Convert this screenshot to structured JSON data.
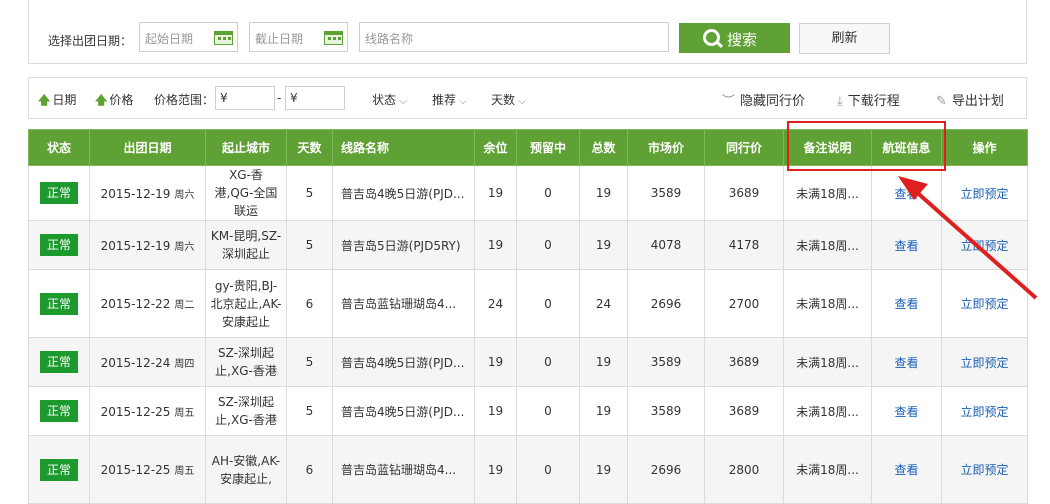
{
  "search": {
    "date_label": "选择出团日期：",
    "start_placeholder": "起始日期",
    "end_placeholder": "截止日期",
    "route_placeholder": "线路名称",
    "search_button": "搜索",
    "refresh_button": "刷新"
  },
  "toolbar": {
    "sort_date": "日期",
    "sort_price": "价格",
    "price_range_label": "价格范围：",
    "price_min": "¥",
    "price_sep": "-",
    "price_max": "¥",
    "status_dd": "状态",
    "recommend_dd": "推荐",
    "days_dd": "天数",
    "hide_peer_price": "隐藏同行价",
    "download_itinerary": "下载行程",
    "export_plan": "导出计划"
  },
  "table": {
    "headers": [
      "状态",
      "出团日期",
      "起止城市",
      "天数",
      "线路名称",
      "余位",
      "预留中",
      "总数",
      "市场价",
      "同行价",
      "备注说明",
      "航班信息",
      "操作"
    ],
    "rows": [
      {
        "status": "正常",
        "date": "2015-12-19",
        "weekday": "周六",
        "cities": "XG-香港,QG-全国联运",
        "days": "5",
        "route": "普吉岛4晚5日游(PJD...",
        "remain": "19",
        "reserved": "0",
        "total": "19",
        "market": "3589",
        "peer": "3689",
        "note": "未满18周...",
        "flight": "查看",
        "action": "立即预定"
      },
      {
        "status": "正常",
        "date": "2015-12-19",
        "weekday": "周六",
        "cities": "KM-昆明,SZ-深圳起止",
        "days": "5",
        "route": "普吉岛5日游(PJD5RY)",
        "remain": "19",
        "reserved": "0",
        "total": "19",
        "market": "4078",
        "peer": "4178",
        "note": "未满18周...",
        "flight": "查看",
        "action": "立即预定"
      },
      {
        "status": "正常",
        "date": "2015-12-22",
        "weekday": "周二",
        "cities": "gy-贵阳,BJ-北京起止,AK-安康起止",
        "days": "6",
        "route": "普吉岛蓝钻珊瑚岛4...",
        "remain": "24",
        "reserved": "0",
        "total": "24",
        "market": "2696",
        "peer": "2700",
        "note": "未满18周...",
        "flight": "查看",
        "action": "立即预定"
      },
      {
        "status": "正常",
        "date": "2015-12-24",
        "weekday": "周四",
        "cities": "SZ-深圳起止,XG-香港",
        "days": "5",
        "route": "普吉岛4晚5日游(PJD...",
        "remain": "19",
        "reserved": "0",
        "total": "19",
        "market": "3589",
        "peer": "3689",
        "note": "未满18周...",
        "flight": "查看",
        "action": "立即预定"
      },
      {
        "status": "正常",
        "date": "2015-12-25",
        "weekday": "周五",
        "cities": "SZ-深圳起止,XG-香港",
        "days": "5",
        "route": "普吉岛4晚5日游(PJD...",
        "remain": "19",
        "reserved": "0",
        "total": "19",
        "market": "3589",
        "peer": "3689",
        "note": "未满18周...",
        "flight": "查看",
        "action": "立即预定"
      },
      {
        "status": "正常",
        "date": "2015-12-25",
        "weekday": "周五",
        "cities": "AH-安徽,AK-安康起止,",
        "days": "6",
        "route": "普吉岛蓝钻珊瑚岛4...",
        "remain": "19",
        "reserved": "0",
        "total": "19",
        "market": "2696",
        "peer": "2800",
        "note": "未满18周...",
        "flight": "查看",
        "action": "立即预定"
      }
    ]
  },
  "colors": {
    "accent": "#5fa134",
    "badge": "#1c9a2e",
    "link": "#1a5fb4",
    "highlight": "#e02020"
  }
}
